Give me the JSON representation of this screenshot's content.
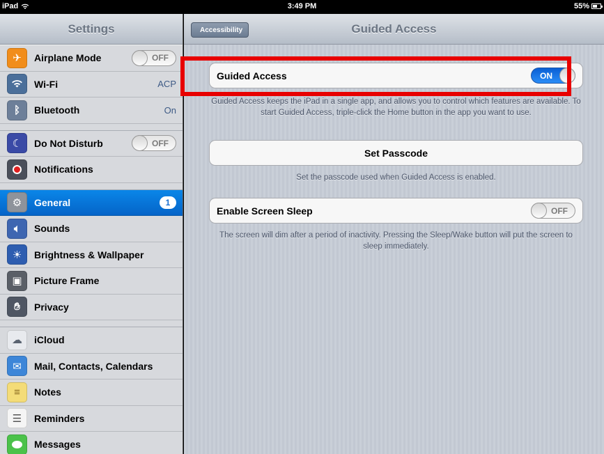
{
  "status_bar": {
    "device": "iPad",
    "time": "3:49 PM",
    "battery": "55%"
  },
  "sidebar": {
    "title": "Settings",
    "groups": [
      [
        {
          "label": "Airplane Mode",
          "icon": "airplane-icon",
          "toggle": "OFF"
        },
        {
          "label": "Wi-Fi",
          "icon": "wifi-icon",
          "value": "ACP"
        },
        {
          "label": "Bluetooth",
          "icon": "bluetooth-icon",
          "value": "On"
        }
      ],
      [
        {
          "label": "Do Not Disturb",
          "icon": "moon-icon",
          "toggle": "OFF"
        },
        {
          "label": "Notifications",
          "icon": "notifications-icon"
        }
      ],
      [
        {
          "label": "General",
          "icon": "gear-icon",
          "badge": "1",
          "selected": true
        },
        {
          "label": "Sounds",
          "icon": "speaker-icon"
        },
        {
          "label": "Brightness & Wallpaper",
          "icon": "brightness-icon"
        },
        {
          "label": "Picture Frame",
          "icon": "picture-frame-icon"
        },
        {
          "label": "Privacy",
          "icon": "hand-icon"
        }
      ],
      [
        {
          "label": "iCloud",
          "icon": "cloud-icon"
        },
        {
          "label": "Mail, Contacts, Calendars",
          "icon": "mail-icon"
        },
        {
          "label": "Notes",
          "icon": "notes-icon"
        },
        {
          "label": "Reminders",
          "icon": "reminders-icon"
        },
        {
          "label": "Messages",
          "icon": "messages-icon"
        }
      ]
    ]
  },
  "detail": {
    "back_label": "Accessibility",
    "title": "Guided Access",
    "guided_access": {
      "label": "Guided Access",
      "toggle": "ON"
    },
    "guided_access_footer": "Guided Access keeps the iPad in a single app, and allows you to control which features are available. To start Guided Access, triple-click the Home button in the app you want to use.",
    "set_passcode": {
      "label": "Set Passcode"
    },
    "set_passcode_footer": "Set the passcode used when Guided Access is enabled.",
    "screen_sleep": {
      "label": "Enable Screen Sleep",
      "toggle": "OFF"
    },
    "screen_sleep_footer": "The screen will dim after a period of inactivity. Pressing the Sleep/Wake button will put the screen to sleep immediately."
  },
  "colors": {
    "highlight": "#e80000",
    "selected_row": "#0a78dc",
    "toggle_on": "#1a73e8"
  }
}
